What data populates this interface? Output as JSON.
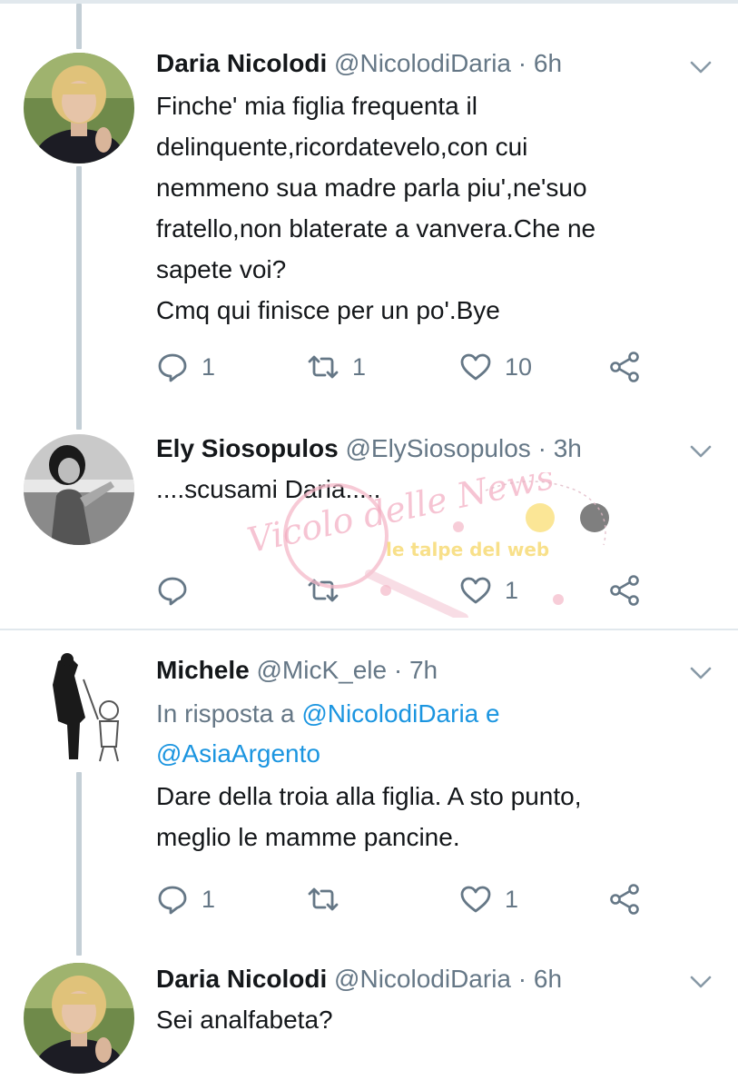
{
  "tweets": [
    {
      "name": "Daria Nicolodi",
      "handle": "@NicolodiDaria",
      "separator": "·",
      "time": "6h",
      "text": "Finche' mia figlia frequenta il\ndelinquente,ricordatevelo,con cui\nnemmeno sua madre parla piu',ne'suo\nfratello,non blaterate a vanvera.Che ne\nsapete voi?\nCmq qui finisce per un po'.Bye",
      "replies": "1",
      "retweets": "1",
      "likes": "10"
    },
    {
      "name": "Ely Siosopulos",
      "handle": "@ElySiosopulos",
      "separator": "·",
      "time": "3h",
      "text": "....scusami Daria.....",
      "replies": "",
      "retweets": "",
      "likes": "1"
    },
    {
      "name": "Michele",
      "handle": "@MicK_ele",
      "separator": "·",
      "time": "7h",
      "reply_prefix": "In risposta a",
      "reply_mention_1": "@NicolodiDaria",
      "reply_conjunction": "e",
      "reply_mention_2": "@AsiaArgento",
      "text": "Dare della troia alla figlia. A sto punto,\nmeglio le mamme pancine.",
      "replies": "1",
      "retweets": "",
      "likes": "1"
    },
    {
      "name": "Daria Nicolodi",
      "handle": "@NicolodiDaria",
      "separator": "·",
      "time": "6h",
      "text": "Sei analfabeta?"
    }
  ],
  "watermark": {
    "logo_text": "Vicolo delle News",
    "banner_text": "le talpe del web"
  },
  "colors": {
    "text": "#14171a",
    "secondary": "#657786",
    "link": "#1b95e0",
    "thread_line": "#c4cfd6",
    "divider": "#e1e8ed"
  },
  "icons": [
    "reply-icon",
    "retweet-icon",
    "like-icon",
    "share-icon",
    "chevron-down-icon"
  ]
}
